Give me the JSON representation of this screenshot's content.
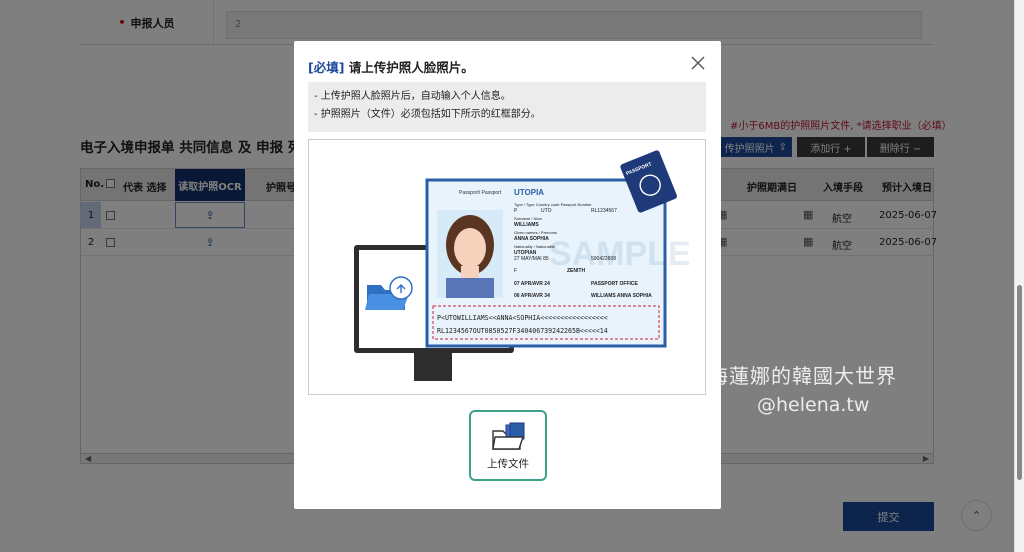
{
  "applicant": {
    "label": "申报人员",
    "value": "2"
  },
  "notice": "#小于6MB的护照照片文件, *请选择职业（必填）",
  "section_title": "电子入境申报单 共同信息 及 申报 列表",
  "buttons": {
    "upload_photo": "传护照照片",
    "add_row": "添加行 +",
    "del_row": "删除行 −",
    "submit": "提交"
  },
  "table": {
    "headers": {
      "no": "No.",
      "rep": "代表 选择",
      "ocr": "读取护照OCR",
      "passport_no": "护照号",
      "expiry": "护照期满日",
      "mode": "入境手段",
      "entry_date": "预计入境日"
    },
    "rows": [
      {
        "no": "1",
        "mode": "航空",
        "date": "2025-06-07"
      },
      {
        "no": "2",
        "mode": "航空",
        "date": "2025-06-07"
      }
    ]
  },
  "watermark": {
    "cn": "海蓮娜的韓國大世界",
    "en": "@helena.tw"
  },
  "modal": {
    "required_tag": "[必填]",
    "title": " 请上传护照人脸照片。",
    "info_lines": [
      "- 上传护照人脸照片后，自动输入个人信息。",
      "- 护照照片（文件）必须包括如下所示的红框部分。"
    ],
    "upload_label": "上传文件"
  },
  "passport_sample": {
    "country": "UTOPIA",
    "header_small": "Passport/ Passport",
    "stamp_text": "PASSPORT",
    "watermark": "SAMPLE",
    "type": "P",
    "code": "UTO",
    "number": "RL1234567",
    "surname": "WILLIAMS",
    "given": "ANNA SOPHIA",
    "nationality": "UTOPIAN",
    "dob": "27 MAY/MAI 85",
    "personal_no": "590422808",
    "sex": "F",
    "place": "ZENITH",
    "issue": "07 APR/AVR 24",
    "authority": "PASSPORT OFFICE",
    "expiry": "06 APR/AVR 34",
    "signature": "WILLIAMS ANNA SOPHIA",
    "mrz1": "P<UTOWILLIAMS<<ANNA<SOPHIA<<<<<<<<<<<<<<<<<",
    "mrz2": "RL1234567OUT0850527F340406739242265B<<<<<14"
  },
  "colors": {
    "brand": "#1a4a9a",
    "accent_green": "#3aa18a",
    "required_red": "#c0152f"
  }
}
